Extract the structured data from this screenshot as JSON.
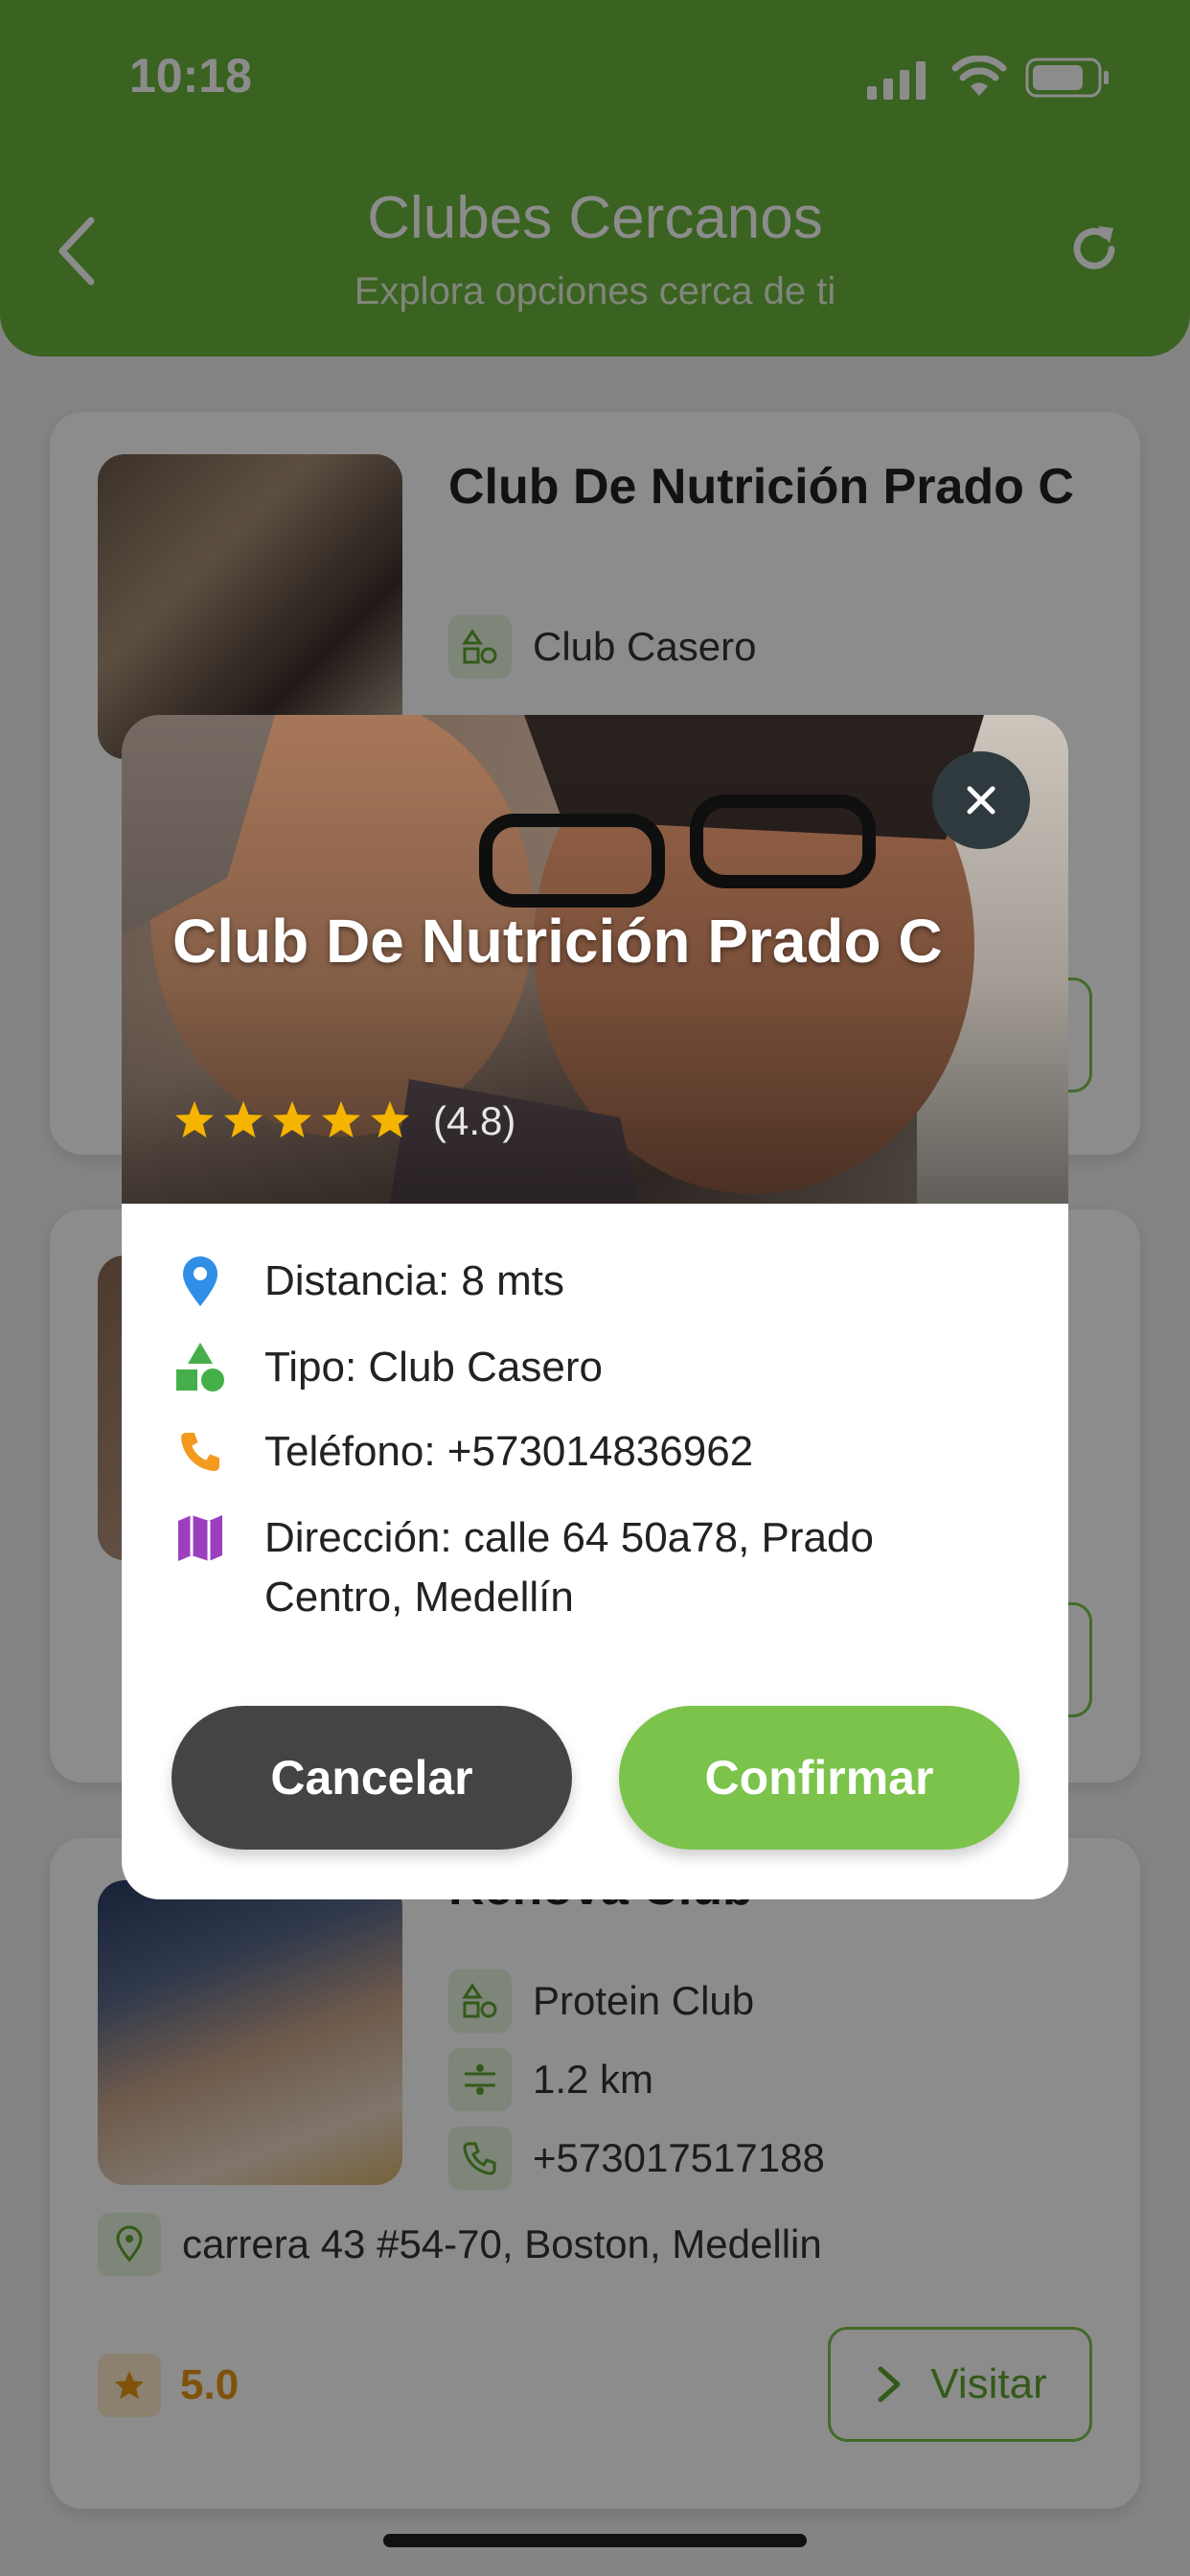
{
  "status_bar": {
    "time": "10:18"
  },
  "header": {
    "title": "Clubes Cercanos",
    "subtitle": "Explora opciones cerca de ti"
  },
  "clubs": [
    {
      "name": "Club De Nutrición Prado C",
      "type": "Club Casero"
    },
    {
      "name": "Renova Club",
      "type": "Protein Club",
      "distance": "1.2 km",
      "phone": "+573017517188",
      "address": "carrera 43 #54-70, Boston, Medellin",
      "rating": "5.0",
      "visit_label": "Visitar"
    }
  ],
  "modal": {
    "title": "Club De Nutrición Prado C",
    "stars": 5,
    "rating": "(4.8)",
    "distance": "Distancia: 8 mts",
    "type": "Tipo: Club Casero",
    "phone": "Teléfono: +573014836962",
    "address": "Dirección: calle 64 50a78, Prado Centro, Medellín",
    "cancel_label": "Cancelar",
    "confirm_label": "Confirmar"
  },
  "colors": {
    "header_green": "#6ab23c",
    "confirm_green": "#7bc34a",
    "cancel_dark": "#444444",
    "star_yellow": "#f5b400",
    "pin_blue": "#2f8ee6",
    "shapes_green": "#45b04a",
    "phone_orange": "#f39a1f",
    "map_purple": "#9b3fbf"
  }
}
